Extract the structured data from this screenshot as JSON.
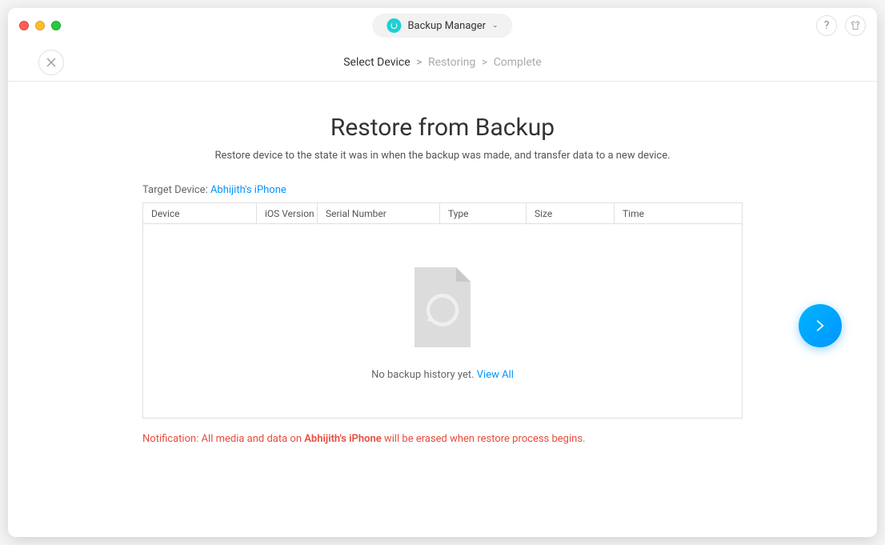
{
  "titlebar": {
    "app_label": "Backup Manager"
  },
  "topbar": {
    "help_char": "?"
  },
  "breadcrumb": {
    "step1": "Select Device",
    "sep1": ">",
    "step2": "Restoring",
    "sep2": ">",
    "step3": "Complete"
  },
  "main": {
    "title": "Restore from Backup",
    "subtitle": "Restore device to the state it was in when the backup was made, and transfer data to a new device.",
    "target_label": "Target Device: ",
    "target_device": "Abhijith's iPhone",
    "table": {
      "columns": {
        "device": "Device",
        "ios": "iOS Version",
        "serial": "Serial Number",
        "type": "Type",
        "size": "Size",
        "time": "Time"
      },
      "empty_text": "No backup history yet. ",
      "view_all": "View All"
    },
    "notification": {
      "prefix": "Notification: All media and data on ",
      "device": "Abhijith's iPhone",
      "suffix": " will be erased when restore process begins."
    }
  }
}
